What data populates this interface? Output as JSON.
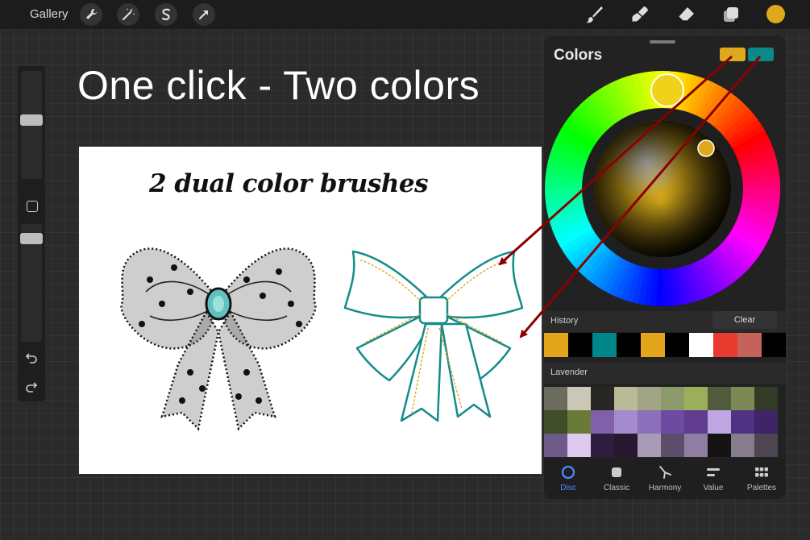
{
  "topbar": {
    "gallery_label": "Gallery",
    "left_tools": [
      "wrench-icon",
      "magic-wand-icon",
      "selection-icon",
      "move-arrow-icon"
    ],
    "right_tools": [
      "brush-icon",
      "smudge-icon",
      "eraser-icon",
      "layers-icon"
    ],
    "current_color": "#e0a81e"
  },
  "sidebar": {
    "brush_size_icon": "brush-size-slider",
    "opacity_icon": "opacity-slider",
    "modify_icon": "square-icon",
    "undo_icon": "undo-icon",
    "redo_icon": "redo-icon"
  },
  "headline": "One click - Two colors",
  "canvas": {
    "title": "2 dual color brushes"
  },
  "colors_panel": {
    "title": "Colors",
    "primary_color": "#e0a81e",
    "secondary_color": "#09898a",
    "history_label": "History",
    "clear_label": "Clear",
    "history": [
      "#e3a51b",
      "#000000",
      "#00878a",
      "#000000",
      "#e3a51b",
      "#000000",
      "#ffffff",
      "#e83a2e",
      "#c5625a",
      "#000000"
    ],
    "palette_name": "Lavender",
    "palette": [
      "#6b6b5e",
      "#cbc8b8",
      "#262722",
      "#b8bb95",
      "#a2a585",
      "#8c9a6c",
      "#9aae5c",
      "#4f5b3a",
      "#7b8a55",
      "#333a25",
      "#3f4d2b",
      "#6a7b38",
      "#8060a8",
      "#a48ace",
      "#8c6fbb",
      "#6d4ba0",
      "#603d8f",
      "#bfa6e3",
      "#4f3282",
      "#3f2466",
      "#6d5a88",
      "#dccbef",
      "#2f1d3f",
      "#27172f",
      "#a79bb5",
      "#5c4d6a",
      "#8f7ea1",
      "#151214",
      "#857c8c",
      "#4d4552"
    ],
    "tabs": [
      {
        "label": "Disc",
        "active": true
      },
      {
        "label": "Classic",
        "active": false
      },
      {
        "label": "Harmony",
        "active": false
      },
      {
        "label": "Value",
        "active": false
      },
      {
        "label": "Palettes",
        "active": false
      }
    ]
  }
}
